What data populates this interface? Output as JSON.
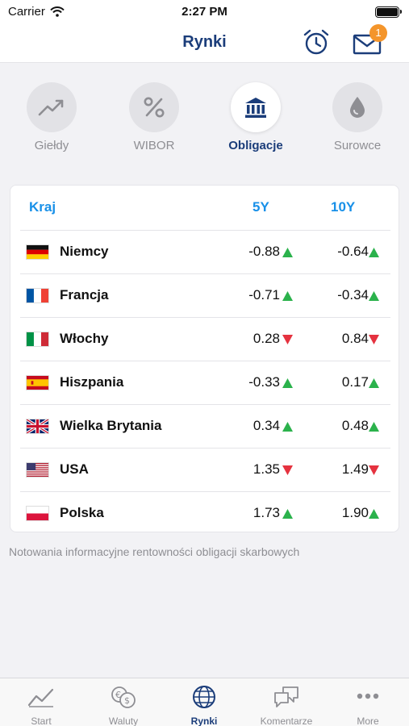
{
  "status_bar": {
    "carrier": "Carrier",
    "time": "2:27 PM"
  },
  "navbar": {
    "title": "Rynki",
    "mail_badge": "1"
  },
  "categories": [
    {
      "label": "Giełdy",
      "icon": "trend-chart-icon",
      "active": false
    },
    {
      "label": "WIBOR",
      "icon": "percent-icon",
      "active": false
    },
    {
      "label": "Obligacje",
      "icon": "bank-building-icon",
      "active": true
    },
    {
      "label": "Surowce",
      "icon": "drop-icon",
      "active": false
    }
  ],
  "table": {
    "headers": {
      "country": "Kraj",
      "y5": "5Y",
      "y10": "10Y"
    },
    "rows": [
      {
        "country": "Niemcy",
        "flag": "de",
        "y5": "-0.88",
        "y5_trend": "up",
        "y10": "-0.64",
        "y10_trend": "up"
      },
      {
        "country": "Francja",
        "flag": "fr",
        "y5": "-0.71",
        "y5_trend": "up",
        "y10": "-0.34",
        "y10_trend": "up"
      },
      {
        "country": "Włochy",
        "flag": "it",
        "y5": "0.28",
        "y5_trend": "down",
        "y10": "0.84",
        "y10_trend": "down"
      },
      {
        "country": "Hiszpania",
        "flag": "es",
        "y5": "-0.33",
        "y5_trend": "up",
        "y10": "0.17",
        "y10_trend": "up"
      },
      {
        "country": "Wielka Brytania",
        "flag": "gb",
        "y5": "0.34",
        "y5_trend": "up",
        "y10": "0.48",
        "y10_trend": "up"
      },
      {
        "country": "USA",
        "flag": "us",
        "y5": "1.35",
        "y5_trend": "down",
        "y10": "1.49",
        "y10_trend": "down"
      },
      {
        "country": "Polska",
        "flag": "pl",
        "y5": "1.73",
        "y5_trend": "up",
        "y10": "1.90",
        "y10_trend": "up"
      }
    ]
  },
  "footnote": "Notowania informacyjne rentowności obligacji skarbowych",
  "tabbar": [
    {
      "label": "Start",
      "icon": "chart-line-icon",
      "active": false
    },
    {
      "label": "Waluty",
      "icon": "currency-icon",
      "active": false
    },
    {
      "label": "Rynki",
      "icon": "globe-icon",
      "active": true
    },
    {
      "label": "Komentarze",
      "icon": "chat-bubbles-icon",
      "active": false
    },
    {
      "label": "More",
      "icon": "more-dots-icon",
      "active": false
    }
  ],
  "colors": {
    "brand": "#1b3d7a",
    "header_accent": "#1890e8",
    "up": "#2bb24c",
    "down": "#e5323f",
    "badge": "#f4952b"
  }
}
